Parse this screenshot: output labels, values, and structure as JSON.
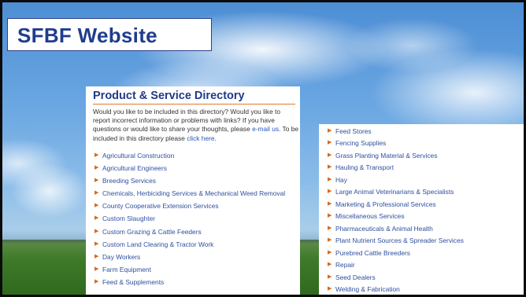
{
  "slide": {
    "title": "SFBF Website"
  },
  "directory": {
    "heading": "Product & Service Directory",
    "intro_part1": "Would you like to be included in this directory? Would you like to report incorrect information or problems with links? If you have questions or would like to share your thoughts, please ",
    "email_link": "e-mail us",
    "intro_part2": ". To be included in this directory please ",
    "click_link": "click here",
    "intro_part3": ".",
    "left_items": [
      "Agricultural Construction",
      "Agricultural Engineers",
      "Breeding Services",
      "Chemicals, Herbiciding Services & Mechanical Weed Removal",
      "County Cooperative Extension Services",
      "Custom Slaughter",
      "Custom Grazing & Cattle Feeders",
      "Custom Land Clearing & Tractor Work",
      "Day Workers",
      "Farm Equipment",
      "Feed & Supplements"
    ],
    "right_items": [
      "Feed Stores",
      "Fencing Supplies",
      "Grass Planting Material & Services",
      "Hauling & Transport",
      "Hay",
      "Large Animal Veterinarians & Specialists",
      "Marketing & Professional Services",
      "Miscellaneous Services",
      "Pharmaceuticals & Animal Health",
      "Plant Nutrient Sources & Spreader Services",
      "Purebred Cattle Breeders",
      "Repair",
      "Seed Dealers",
      "Welding & Fabrication"
    ],
    "bullet_icon": "triangle-right-icon",
    "accent_color": "#e07a2a",
    "link_color": "#2e4f9e"
  }
}
